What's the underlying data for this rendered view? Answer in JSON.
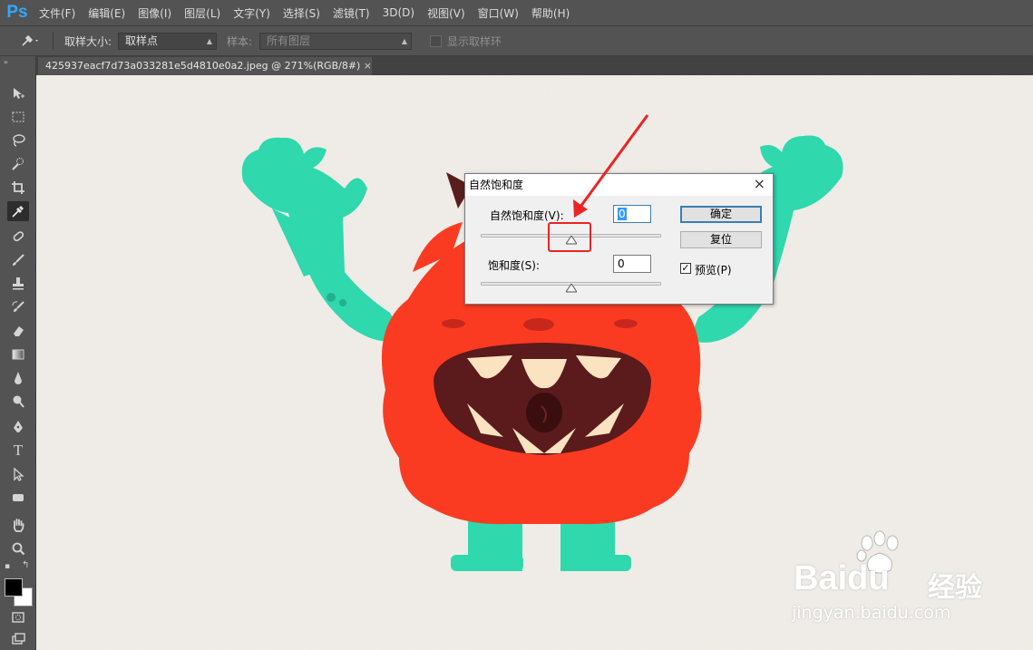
{
  "app": {
    "logo": "Ps"
  },
  "menu": [
    "文件(F)",
    "编辑(E)",
    "图像(I)",
    "图层(L)",
    "文字(Y)",
    "选择(S)",
    "滤镜(T)",
    "3D(D)",
    "视图(V)",
    "窗口(W)",
    "帮助(H)"
  ],
  "options": {
    "sample_size_label": "取样大小:",
    "sample_size_value": "取样点",
    "sample_label": "样本:",
    "sample_value": "所有图层",
    "show_ring_label": "显示取样环"
  },
  "document": {
    "tab_title": "425937eacf7d73a033281e5d4810e0a2.jpeg @ 271%(RGB/8#)",
    "close": "×"
  },
  "dialog": {
    "title": "自然饱和度",
    "close": "×",
    "vibrance_label": "自然饱和度(V):",
    "vibrance_value": "0",
    "saturation_label": "饱和度(S):",
    "saturation_value": "0",
    "ok_label": "确定",
    "reset_label": "复位",
    "preview_label": "预览(P)",
    "preview_checked": true,
    "vibrance_slider_level": 0.5,
    "saturation_slider_level": 0.5
  },
  "watermark": {
    "brand": "Bai",
    "brand2": "du",
    "service": "经验",
    "url": "jingyan.baidu.com"
  },
  "colors": {
    "annotation_red": "#ea2424",
    "monster_red": "#fa3b22",
    "monster_teal": "#2fd8ad",
    "ps_blue": "#31a8ff",
    "button_focus": "#3c7fb1"
  }
}
